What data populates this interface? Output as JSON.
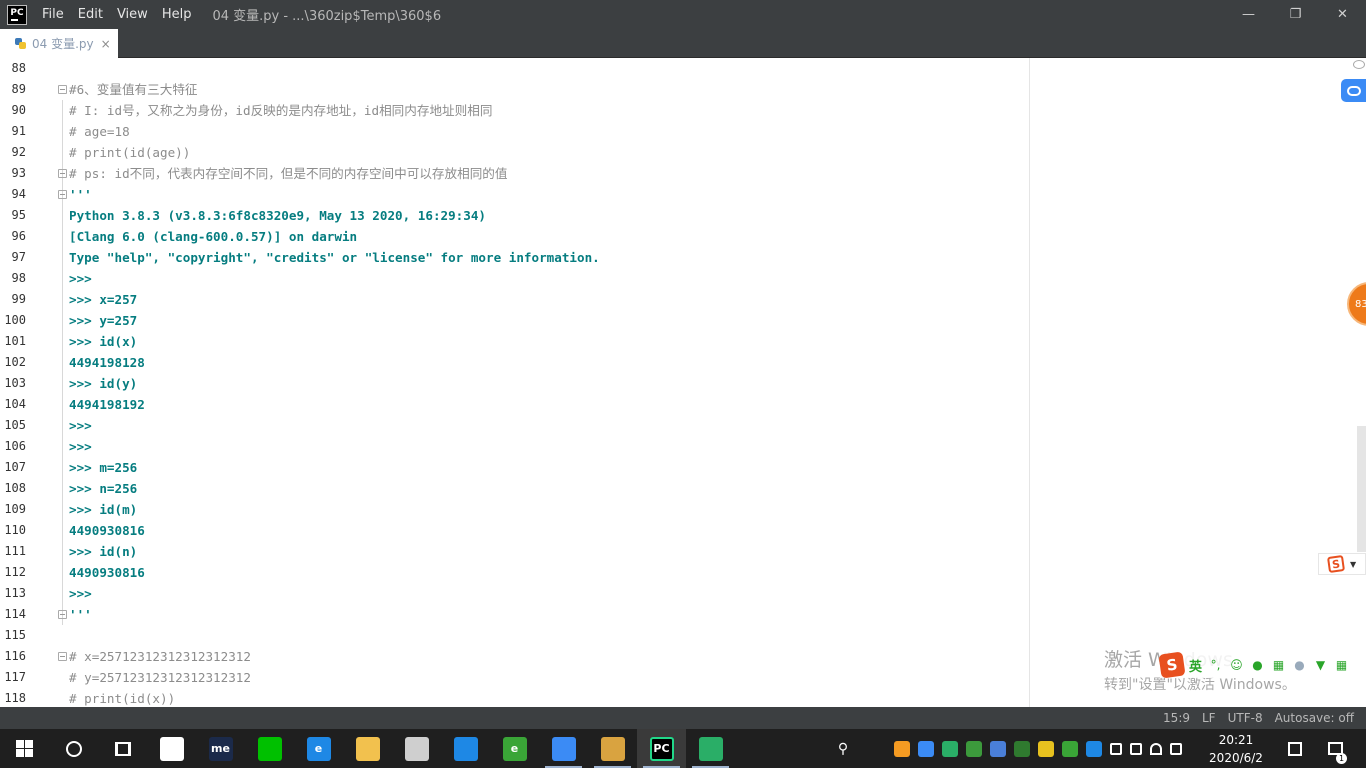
{
  "titlebar": {
    "app_logo": "PC",
    "menu": [
      "File",
      "Edit",
      "View",
      "Help"
    ],
    "window_title": "04 变量.py - ...\\360zip$Temp\\360$6",
    "controls": {
      "minimize": "—",
      "restore": "❐",
      "close": "✕"
    }
  },
  "tab": {
    "label": "04 变量.py",
    "close": "×"
  },
  "editor": {
    "lines": [
      {
        "num": "88",
        "text": "",
        "style": "plain",
        "fold": false
      },
      {
        "num": "89",
        "text": "#6、变量值有三大特征",
        "style": "comment",
        "fold": true
      },
      {
        "num": "90",
        "text": "# I: id号，又称之为身份，id反映的是内存地址，id相同内存地址则相同",
        "style": "comment",
        "fold": false
      },
      {
        "num": "91",
        "text": "# age=18",
        "style": "comment",
        "fold": false
      },
      {
        "num": "92",
        "text": "# print(id(age))",
        "style": "comment",
        "fold": false
      },
      {
        "num": "93",
        "text": "# ps: id不同，代表内存空间不同，但是不同的内存空间中可以存放相同的值",
        "style": "comment",
        "fold": true
      },
      {
        "num": "94",
        "text": "'''",
        "style": "doc",
        "fold": true
      },
      {
        "num": "95",
        "text": "Python 3.8.3 (v3.8.3:6f8c8320e9, May 13 2020, 16:29:34)",
        "style": "doc",
        "fold": false
      },
      {
        "num": "96",
        "text": "[Clang 6.0 (clang-600.0.57)] on darwin",
        "style": "doc",
        "fold": false
      },
      {
        "num": "97",
        "text": "Type \"help\", \"copyright\", \"credits\" or \"license\" for more information.",
        "style": "doc",
        "fold": false
      },
      {
        "num": "98",
        "text": ">>>",
        "style": "doc",
        "fold": false
      },
      {
        "num": "99",
        "text": ">>> x=257",
        "style": "doc",
        "fold": false
      },
      {
        "num": "100",
        "text": ">>> y=257",
        "style": "doc",
        "fold": false
      },
      {
        "num": "101",
        "text": ">>> id(x)",
        "style": "doc",
        "fold": false
      },
      {
        "num": "102",
        "text": "4494198128",
        "style": "doc",
        "fold": false
      },
      {
        "num": "103",
        "text": ">>> id(y)",
        "style": "doc",
        "fold": false
      },
      {
        "num": "104",
        "text": "4494198192",
        "style": "doc",
        "fold": false
      },
      {
        "num": "105",
        "text": ">>>",
        "style": "doc",
        "fold": false
      },
      {
        "num": "106",
        "text": ">>>",
        "style": "doc",
        "fold": false
      },
      {
        "num": "107",
        "text": ">>> m=256",
        "style": "doc",
        "fold": false
      },
      {
        "num": "108",
        "text": ">>> n=256",
        "style": "doc",
        "fold": false
      },
      {
        "num": "109",
        "text": ">>> id(m)",
        "style": "doc",
        "fold": false
      },
      {
        "num": "110",
        "text": "4490930816",
        "style": "doc",
        "fold": false
      },
      {
        "num": "111",
        "text": ">>> id(n)",
        "style": "doc",
        "fold": false
      },
      {
        "num": "112",
        "text": "4490930816",
        "style": "doc",
        "fold": false
      },
      {
        "num": "113",
        "text": ">>>",
        "style": "doc",
        "fold": false
      },
      {
        "num": "114",
        "text": "'''",
        "style": "doc",
        "fold": true
      },
      {
        "num": "115",
        "text": "",
        "style": "plain",
        "fold": false
      },
      {
        "num": "116",
        "text": "# x=25712312312312312312",
        "style": "comment",
        "fold": true
      },
      {
        "num": "117",
        "text": "# y=25712312312312312312",
        "style": "comment",
        "fold": false
      },
      {
        "num": "118",
        "text": "# print(id(x))",
        "style": "comment",
        "fold": false
      }
    ]
  },
  "floating": {
    "orange_ball": "83"
  },
  "activation": {
    "line1": "激活 Windows",
    "line2": "转到\"设置\"以激活 Windows。"
  },
  "ime": {
    "logo": "S",
    "mode": "英",
    "icons": [
      "punct-icon",
      "smile-icon",
      "mic-icon",
      "keyboard-icon",
      "user-icon",
      "skin-icon",
      "grid-icon"
    ]
  },
  "statusbar": {
    "position": "15:9",
    "line_sep": "LF",
    "encoding": "UTF-8",
    "autosave": "Autosave: off"
  },
  "taskbar": {
    "apps": [
      {
        "name": "pinwheel",
        "color": "#ffffff",
        "label": ""
      },
      {
        "name": "me",
        "color": "#1b2a4a",
        "label": "me"
      },
      {
        "name": "iqiyi",
        "color": "#00c000",
        "label": ""
      },
      {
        "name": "edge",
        "color": "#1e88e5",
        "label": "e"
      },
      {
        "name": "explorer",
        "color": "#f2c14e",
        "label": ""
      },
      {
        "name": "store",
        "color": "#cfcfcf",
        "label": ""
      },
      {
        "name": "mail",
        "color": "#1e88e5",
        "label": ""
      },
      {
        "name": "360browser",
        "color": "#3aa537",
        "label": "e"
      },
      {
        "name": "baidu-netdisk",
        "color": "#3b8bf5",
        "label": ""
      },
      {
        "name": "archive",
        "color": "#d9a340",
        "label": ""
      },
      {
        "name": "pycharm",
        "color": "#21d789",
        "label": "PC"
      },
      {
        "name": "wechat",
        "color": "#2aae67",
        "label": ""
      }
    ],
    "tray_icons": [
      "orange-icon",
      "cloud-icon",
      "wechat-tray-icon",
      "shield-icon",
      "translate-icon",
      "defender-icon",
      "plus-icon",
      "360-icon",
      "bluetooth-icon",
      "temp-icon",
      "battery-icon",
      "wifi-icon",
      "volume-icon"
    ],
    "time": "20:21",
    "date": "2020/6/2",
    "notifications_count": "1"
  }
}
